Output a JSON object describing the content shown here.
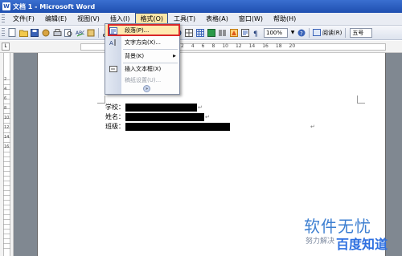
{
  "window": {
    "title": "文档 1 - Microsoft Word",
    "app_icon": "W"
  },
  "menubar": {
    "items": [
      {
        "label": "文件(F)"
      },
      {
        "label": "编辑(E)"
      },
      {
        "label": "视图(V)"
      },
      {
        "label": "插入(I)"
      },
      {
        "label": "格式(O)"
      },
      {
        "label": "工具(T)"
      },
      {
        "label": "表格(A)"
      },
      {
        "label": "窗口(W)"
      },
      {
        "label": "帮助(H)"
      }
    ],
    "active": "格式(O)"
  },
  "toolbar": {
    "zoom": "100%",
    "read_label": "阅读(R)",
    "font_size": "五号"
  },
  "ruler": {
    "h_numbers": [
      "2",
      "4",
      "6",
      "8",
      "10",
      "12",
      "14",
      "16",
      "18",
      "20"
    ],
    "v_numbers": [
      "2",
      "4",
      "6",
      "8",
      "10",
      "12",
      "14",
      "16"
    ]
  },
  "format_menu": {
    "items": [
      {
        "label": "段落(P)...",
        "icon": "paragraph-icon",
        "state": "highlighted"
      },
      {
        "label": "文字方向(X)...",
        "icon": "text-direction-icon",
        "state": "normal"
      },
      {
        "label": "背景(K)",
        "icon": "",
        "state": "normal",
        "has_submenu": true
      },
      {
        "label": "插入文本框(X)",
        "icon": "textbox-icon",
        "state": "normal"
      },
      {
        "label": "稿纸设置(U)...",
        "icon": "",
        "state": "disabled"
      }
    ],
    "expand_glyph": "»"
  },
  "document": {
    "lines": [
      {
        "label": "学校：",
        "mark": "↵"
      },
      {
        "label": "姓名：",
        "mark": "↵"
      },
      {
        "label": "班级：",
        "mark": ""
      }
    ],
    "para_mark": "↵"
  },
  "watermark": {
    "main": "软件无忧",
    "sub": "努力解决",
    "brand": "百度知道"
  },
  "colors": {
    "titlebar": "#1f4fb0",
    "menu_active": "#fbe6a8",
    "highlight_box": "#d8262a",
    "watermark_blue": "#3d7fd1"
  }
}
